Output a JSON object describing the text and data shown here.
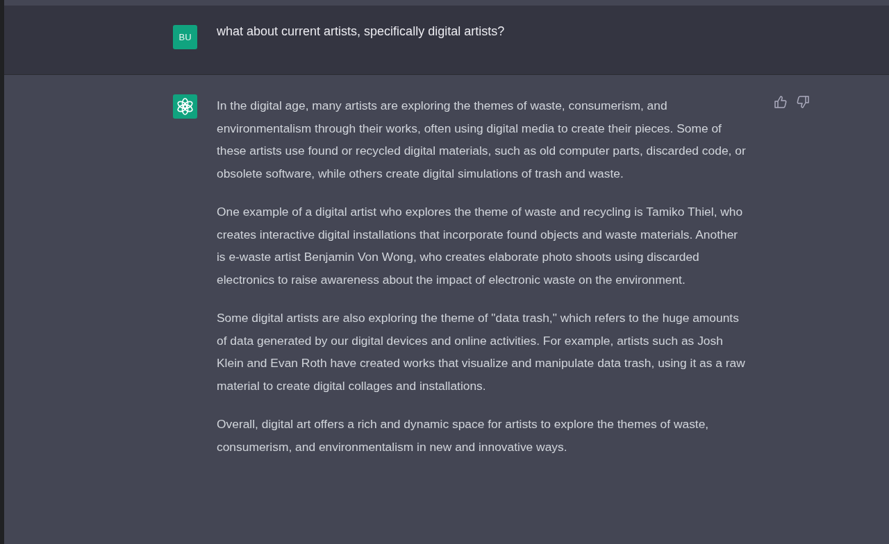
{
  "user_message": {
    "avatar": "BU",
    "text": "what about current artists, specifically digital artists?"
  },
  "assistant_message": {
    "paragraphs": [
      "In the digital age, many artists are exploring the themes of waste, consumerism, and environmentalism through their works, often using digital media to create their pieces. Some of these artists use found or recycled digital materials, such as old computer parts, discarded code, or obsolete software, while others create digital simulations of trash and waste.",
      "One example of a digital artist who explores the theme of waste and recycling is Tamiko Thiel, who creates interactive digital installations that incorporate found objects and waste materials. Another is e-waste artist Benjamin Von Wong, who creates elaborate photo shoots using discarded electronics to raise awareness about the impact of electronic waste on the environment.",
      "Some digital artists are also exploring the theme of \"data trash,\" which refers to the huge amounts of data generated by our digital devices and online activities. For example, artists such as Josh Klein and Evan Roth have created works that visualize and manipulate data trash, using it as a raw material to create digital collages and installations.",
      "Overall, digital art offers a rich and dynamic space for artists to explore the themes of waste, consumerism, and environmentalism in new and innovative ways."
    ]
  }
}
